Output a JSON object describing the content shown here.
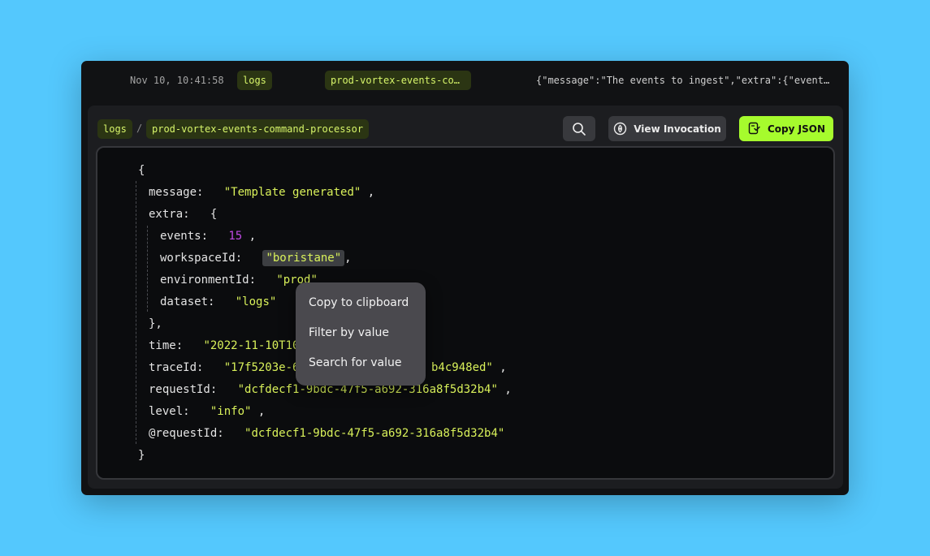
{
  "log_row": {
    "timestamp": "Nov 10, 10:41:58",
    "source_tag": "logs",
    "function_tag": "prod-vortex-events-co…",
    "preview": "{\"message\":\"The events to ingest\",\"extra\":{\"event…"
  },
  "breadcrumb": {
    "dataset": "logs",
    "separator": "/",
    "function": "prod-vortex-events-command-processor"
  },
  "toolbar": {
    "view_invocation_label": "View Invocation",
    "copy_json_label": "Copy JSON"
  },
  "json_viewer": {
    "open_brace": "{",
    "close_brace": "}",
    "message_key": "message:",
    "message_value": "\"Template generated\"",
    "extra_key": "extra:",
    "extra_open": "{",
    "extra_close": "},",
    "events_key": "events:",
    "events_value": "15",
    "workspace_key": "workspaceId:",
    "workspace_value": "\"boristane\"",
    "environment_key": "environmentId:",
    "environment_value": "\"prod\"",
    "dataset_key": "dataset:",
    "dataset_value": "\"logs\"",
    "time_key": "time:",
    "time_value": "\"2022-11-10T10",
    "trace_key": "traceId:",
    "trace_value_start": "\"17f5203e-6",
    "trace_value_end": "b4c948ed\"",
    "request_key": "requestId:",
    "request_value": "\"dcfdecf1-9bdc-47f5-a692-316a8f5d32b4\"",
    "level_key": "level:",
    "level_value": "\"info\"",
    "at_request_key": "@requestId:",
    "at_request_value": "\"dcfdecf1-9bdc-47f5-a692-316a8f5d32b4\"",
    "comma": ","
  },
  "context_menu": {
    "items": [
      "Copy to clipboard",
      "Filter by value",
      "Search for value"
    ]
  },
  "colors": {
    "background": "#54c8fd",
    "accent": "#a6fb2d",
    "string": "#d9f15a",
    "number": "#c14be6"
  },
  "icons": {
    "search": "search-icon",
    "view_invocation": "eye-icon",
    "copy_json": "copy-icon"
  }
}
